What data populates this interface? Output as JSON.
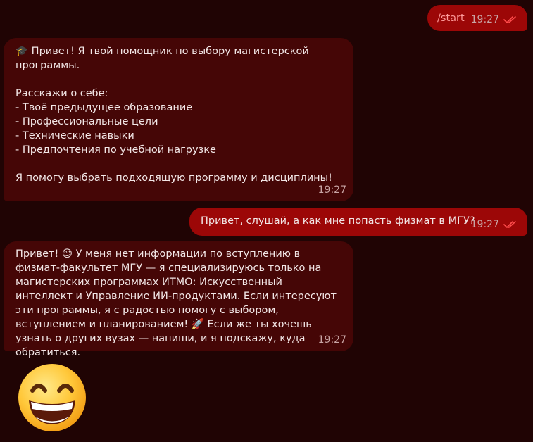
{
  "messages": [
    {
      "id": "m1",
      "direction": "outgoing",
      "text": "/start",
      "time": "19:27",
      "read": true
    },
    {
      "id": "m2",
      "direction": "incoming",
      "text": "🎓 Привет! Я твой помощник по выбору магистерской программы.\n\nРасскажи о себе:\n- Твоё предыдущее образование\n- Профессиональные цели\n- Технические навыки\n- Предпочтения по учебной нагрузке\n\nЯ помогу выбрать подходящую программу и дисциплины!",
      "time": "19:27"
    },
    {
      "id": "m3",
      "direction": "outgoing",
      "text": "Привет, слушай, а как мне попасть физмат в  МГУ?",
      "time": "19:27",
      "read": true
    },
    {
      "id": "m4",
      "direction": "incoming",
      "text": "Привет! 😊 У меня нет информации по вступлению в физмат-факультет МГУ — я специализируюсь только на магистерских программах ИТМО: Искусственный интеллект и Управление ИИ-продуктами. Если интересуют эти программы, я с радостью помогу с выбором, вступлением и планированием! 🚀 Если же ты хочешь узнать о других вузах — напиши, и я подскажу, куда обратиться.",
      "time": "19:27"
    }
  ],
  "sticker": {
    "icon": "grinning-face-sticker"
  },
  "colors": {
    "background": "#200404",
    "outgoing_bubble": "#9c0707",
    "incoming_bubble": "#450606",
    "read_ticks": "#ff4d4d"
  }
}
